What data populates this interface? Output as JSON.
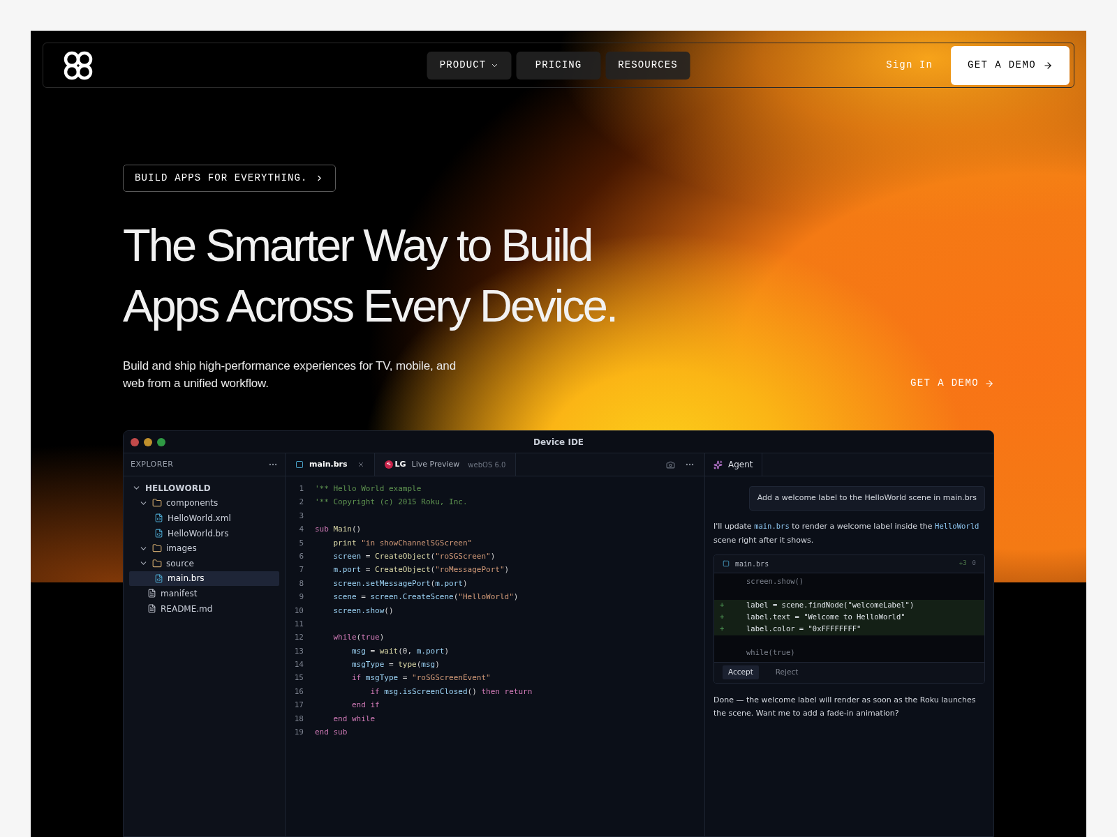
{
  "nav": {
    "links": [
      {
        "label": "PRODUCT",
        "has_menu": true
      },
      {
        "label": "PRICING",
        "has_menu": false
      },
      {
        "label": "RESOURCES",
        "has_menu": false
      }
    ],
    "sign_in": "Sign In",
    "cta": "GET A DEMO"
  },
  "hero": {
    "badge": "BUILD APPS FOR EVERYTHING.",
    "title_lines": [
      "The Smarter Way to Build",
      "Apps Across Every Device."
    ],
    "subtitle": "Build and ship high-performance experiences for TV, mobile, and web from a unified workflow.",
    "cta": "GET A DEMO"
  },
  "ide": {
    "title": "Device IDE",
    "explorer": {
      "title": "EXPLORER",
      "tree": [
        {
          "name": "HELLOWORLD",
          "kind": "root",
          "expanded": true,
          "selected": false,
          "children": [
            {
              "name": "components",
              "kind": "folder",
              "expanded": true,
              "selected": false,
              "children": [
                {
                  "name": "HelloWorld.xml",
                  "kind": "code-file",
                  "selected": false
                },
                {
                  "name": "HelloWorld.brs",
                  "kind": "code-file",
                  "selected": false
                }
              ]
            },
            {
              "name": "images",
              "kind": "folder",
              "expanded": true,
              "selected": false
            },
            {
              "name": "source",
              "kind": "folder",
              "expanded": true,
              "selected": false,
              "children": [
                {
                  "name": "main.brs",
                  "kind": "code-file",
                  "selected": true
                }
              ]
            },
            {
              "name": "manifest",
              "kind": "text-file",
              "selected": false
            },
            {
              "name": "README.md",
              "kind": "text-file",
              "selected": false
            }
          ]
        }
      ]
    },
    "editor": {
      "tabs": [
        {
          "kind": "file",
          "label": "main.brs",
          "selected": true
        },
        {
          "kind": "preview",
          "brand": "LG",
          "label": "Live Preview",
          "detail": "webOS 6.0",
          "selected": false
        }
      ],
      "lines": [
        {
          "number": "1",
          "tokens": [
            {
              "kind": "comment",
              "text": "'** Hello World example"
            }
          ]
        },
        {
          "number": "2",
          "tokens": [
            {
              "kind": "comment",
              "text": "'** Copyright (c) 2015 Roku, Inc."
            }
          ]
        },
        {
          "number": "3"
        },
        {
          "number": "4",
          "tokens": [
            {
              "kind": "keyword",
              "text": "sub "
            },
            {
              "kind": "func",
              "text": "Main"
            },
            {
              "kind": "plain",
              "text": "()"
            }
          ]
        },
        {
          "number": "5",
          "tokens": [
            {
              "kind": "func",
              "text": "    print "
            },
            {
              "kind": "string",
              "text": "\"in showChannelSGScreen\""
            }
          ]
        },
        {
          "number": "6",
          "tokens": [
            {
              "kind": "var",
              "text": "    screen"
            },
            {
              "kind": "plain",
              "text": " = "
            },
            {
              "kind": "func",
              "text": "CreateObject"
            },
            {
              "kind": "plain",
              "text": "("
            },
            {
              "kind": "string",
              "text": "\"roSGScreen\""
            },
            {
              "kind": "plain",
              "text": ")"
            }
          ]
        },
        {
          "number": "7",
          "tokens": [
            {
              "kind": "var",
              "text": "    m.port"
            },
            {
              "kind": "plain",
              "text": " = "
            },
            {
              "kind": "func",
              "text": "CreateObject"
            },
            {
              "kind": "plain",
              "text": "("
            },
            {
              "kind": "string",
              "text": "\"roMessagePort\""
            },
            {
              "kind": "plain",
              "text": ")"
            }
          ]
        },
        {
          "number": "8",
          "tokens": [
            {
              "kind": "var",
              "text": "    screen.setMessagePort"
            },
            {
              "kind": "plain",
              "text": "("
            },
            {
              "kind": "var",
              "text": "m.port"
            },
            {
              "kind": "plain",
              "text": ")"
            }
          ]
        },
        {
          "number": "9",
          "tokens": [
            {
              "kind": "var",
              "text": "    scene"
            },
            {
              "kind": "plain",
              "text": " = "
            },
            {
              "kind": "var",
              "text": "screen.CreateScene"
            },
            {
              "kind": "plain",
              "text": "("
            },
            {
              "kind": "string",
              "text": "\"HelloWorld\""
            },
            {
              "kind": "plain",
              "text": ")"
            }
          ]
        },
        {
          "number": "10",
          "tokens": [
            {
              "kind": "var",
              "text": "    screen.show"
            },
            {
              "kind": "plain",
              "text": "()"
            }
          ]
        },
        {
          "number": "11"
        },
        {
          "number": "12",
          "tokens": [
            {
              "kind": "keyword",
              "text": "    while"
            },
            {
              "kind": "plain",
              "text": "("
            },
            {
              "kind": "keyword",
              "text": "true"
            },
            {
              "kind": "plain",
              "text": ")"
            }
          ]
        },
        {
          "number": "13",
          "tokens": [
            {
              "kind": "var",
              "text": "        msg"
            },
            {
              "kind": "plain",
              "text": " = "
            },
            {
              "kind": "func",
              "text": "wait"
            },
            {
              "kind": "plain",
              "text": "(0, "
            },
            {
              "kind": "var",
              "text": "m.port"
            },
            {
              "kind": "plain",
              "text": ")"
            }
          ]
        },
        {
          "number": "14",
          "tokens": [
            {
              "kind": "var",
              "text": "        msgType"
            },
            {
              "kind": "plain",
              "text": " = "
            },
            {
              "kind": "func",
              "text": "type"
            },
            {
              "kind": "plain",
              "text": "("
            },
            {
              "kind": "var",
              "text": "msg"
            },
            {
              "kind": "plain",
              "text": ")"
            }
          ]
        },
        {
          "number": "15",
          "tokens": [
            {
              "kind": "keyword",
              "text": "        if "
            },
            {
              "kind": "var",
              "text": "msgType"
            },
            {
              "kind": "plain",
              "text": " = "
            },
            {
              "kind": "string",
              "text": "\"roSGScreenEvent\""
            }
          ]
        },
        {
          "number": "16",
          "tokens": [
            {
              "kind": "keyword",
              "text": "            if "
            },
            {
              "kind": "var",
              "text": "msg.isScreenClosed"
            },
            {
              "kind": "plain",
              "text": "() "
            },
            {
              "kind": "keyword",
              "text": "then return"
            }
          ]
        },
        {
          "number": "17",
          "tokens": [
            {
              "kind": "keyword",
              "text": "        end if"
            }
          ]
        },
        {
          "number": "18",
          "tokens": [
            {
              "kind": "keyword",
              "text": "    end while"
            }
          ]
        },
        {
          "number": "19",
          "tokens": [
            {
              "kind": "keyword",
              "text": "end sub"
            }
          ]
        }
      ]
    },
    "agent": {
      "tab": "Agent",
      "request": "Add a welcome label to the HelloWorld scene in main.brs",
      "reply": [
        {
          "kind": "text",
          "text": "I'll update "
        },
        {
          "kind": "code",
          "text": "main.brs"
        },
        {
          "kind": "text",
          "text": " to render a welcome label inside the "
        },
        {
          "kind": "code",
          "text": "HelloWorld"
        },
        {
          "kind": "text",
          "text": " scene right after it shows."
        }
      ],
      "diff": {
        "file": "main.brs",
        "added": "+3",
        "removed": "0",
        "lines": [
          {
            "kind": "context",
            "text": "screen.show()"
          },
          {
            "kind": "blank"
          },
          {
            "kind": "added",
            "marker": "+",
            "text": "label = scene.findNode(\"welcomeLabel\")"
          },
          {
            "kind": "added",
            "marker": "+",
            "text": "label.text = \"Welcome to HelloWorld\""
          },
          {
            "kind": "added",
            "marker": "+",
            "text": "label.color = \"0xFFFFFFFF\""
          },
          {
            "kind": "blank"
          },
          {
            "kind": "context",
            "text": "while(true)"
          }
        ],
        "actions": [
          {
            "label": "Accept",
            "primary": true
          },
          {
            "label": "Reject",
            "primary": false
          }
        ]
      },
      "final": "Done — the welcome label will render as soon as the Roku launches the scene. Want me to add a fade-in animation?"
    }
  }
}
